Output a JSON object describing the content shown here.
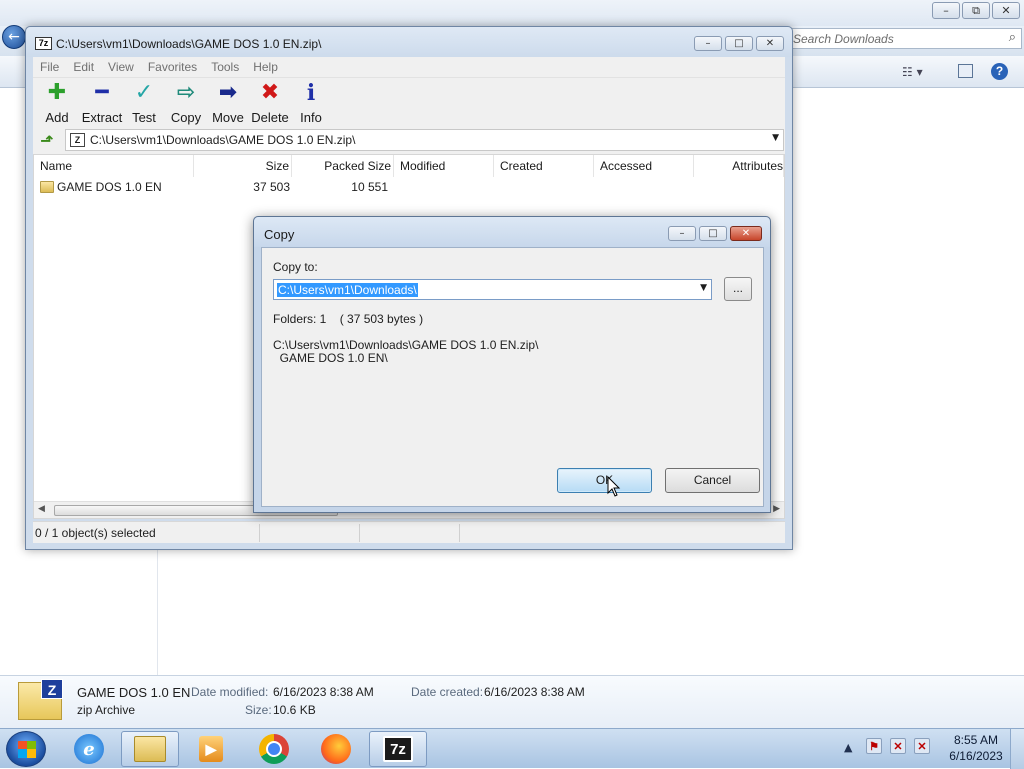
{
  "explorer": {
    "search_placeholder": "Search Downloads",
    "details": {
      "file_name": "GAME DOS 1.0 EN",
      "file_type": "zip Archive",
      "date_modified_label": "Date modified:",
      "date_modified_value": "6/16/2023 8:38 AM",
      "date_created_label": "Date created:",
      "date_created_value": "6/16/2023 8:38 AM",
      "size_label": "Size:",
      "size_value": "10.6 KB"
    }
  },
  "filemanager": {
    "title": "C:\\Users\\vm1\\Downloads\\GAME DOS 1.0 EN.zip\\",
    "menu": [
      "File",
      "Edit",
      "View",
      "Favorites",
      "Tools",
      "Help"
    ],
    "toolbar": [
      {
        "label": "Add",
        "icon": "plus-icon",
        "color": "#2ca02c"
      },
      {
        "label": "Extract",
        "icon": "minus-icon",
        "color": "#1f2fa8"
      },
      {
        "label": "Test",
        "icon": "check-icon",
        "color": "#25a6a6"
      },
      {
        "label": "Copy",
        "icon": "copy-arrow-icon",
        "color": "#1f8a7a"
      },
      {
        "label": "Move",
        "icon": "move-arrow-icon",
        "color": "#1a2a8c"
      },
      {
        "label": "Delete",
        "icon": "delete-x-icon",
        "color": "#d01818"
      },
      {
        "label": "Info",
        "icon": "info-icon",
        "color": "#1f2fa8"
      }
    ],
    "path": "C:\\Users\\vm1\\Downloads\\GAME DOS 1.0 EN.zip\\",
    "columns": [
      "Name",
      "Size",
      "Packed Size",
      "Modified",
      "Created",
      "Accessed",
      "Attributes"
    ],
    "rows": [
      {
        "name": "GAME DOS 1.0 EN",
        "size": "37 503",
        "packed_size": "10 551",
        "modified": "",
        "created": "",
        "accessed": "",
        "attributes": ""
      }
    ],
    "status": "0 / 1 object(s) selected"
  },
  "copy_dialog": {
    "title": "Copy",
    "copy_to_label": "Copy to:",
    "copy_to_value": "C:\\Users\\vm1\\Downloads\\",
    "browse_label": "...",
    "folders_info": "Folders: 1    ( 37 503 bytes )",
    "source_path": "C:\\Users\\vm1\\Downloads\\GAME DOS 1.0 EN.zip\\",
    "source_item": "  GAME DOS 1.0 EN\\",
    "ok_label": "OK",
    "cancel_label": "Cancel"
  },
  "taskbar": {
    "time": "8:55 AM",
    "date": "6/16/2023",
    "apps": [
      "internet-explorer",
      "file-explorer",
      "media-player",
      "chrome",
      "firefox",
      "7-zip"
    ]
  }
}
